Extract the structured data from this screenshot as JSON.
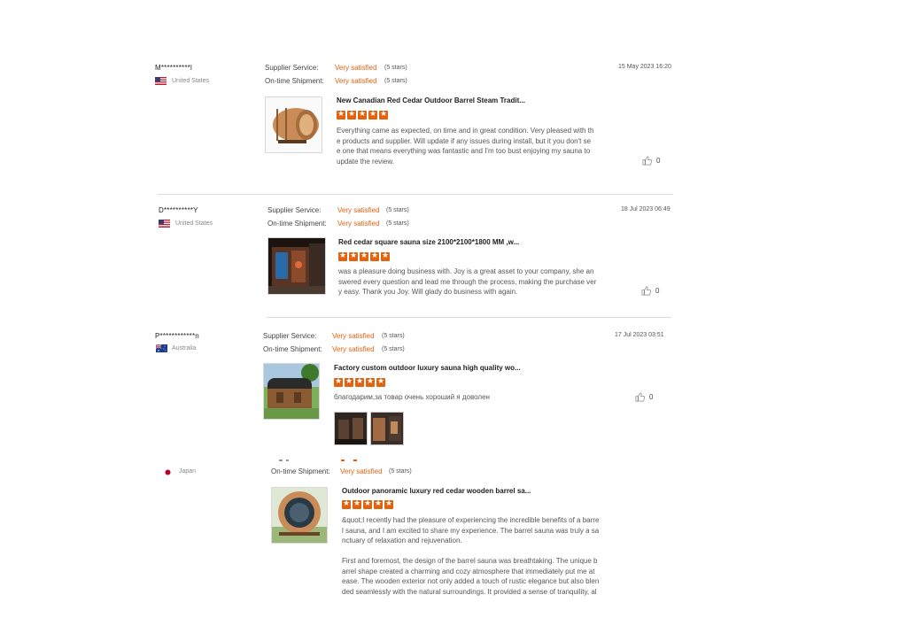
{
  "labels": {
    "supplier_service": "Supplier Service:",
    "on_time_shipment": "On-time Shipment:"
  },
  "colors": {
    "accent": "#e2620f",
    "divider": "#dddddd"
  },
  "reviews": [
    {
      "user": "M**********l",
      "country": "United States",
      "flag": "us-flag-icon",
      "supplier_service": "Very satisfied",
      "supplier_service_stars": "(5 stars)",
      "on_time_shipment": "Very satisfied",
      "on_time_shipment_stars": "(5 stars)",
      "date": "15 May 2023 16:20",
      "product_title": "New Canadian Red Cedar Outdoor Barrel Steam Tradit...",
      "rating": 5,
      "text_lines": [
        "Everything came as expected, on time and in great condition. Very pleased with th",
        "e products and supplier. Will update if any issues during install, but it you don't se",
        "e one that means everything was fantastic and I'm too bust enjoying my sauna to",
        "update the review."
      ],
      "likes": "0"
    },
    {
      "user": "D**********Y",
      "country": "United States",
      "flag": "us-flag-icon",
      "supplier_service": "Very satisfied",
      "supplier_service_stars": "(5 stars)",
      "on_time_shipment": "Very satisfied",
      "on_time_shipment_stars": "(5 stars)",
      "date": "18 Jul 2023 06:49",
      "product_title": "Red cedar square sauna size 2100*2100*1800 MM ,w...",
      "rating": 5,
      "text_lines": [
        "was a pleasure doing business with. Joy is a great asset to your company, she an",
        "swered every question and lead me through the process, making the purchase ver",
        "y easy. Thank you Joy. Will glady do business with again."
      ],
      "likes": "0"
    },
    {
      "user": "P************n",
      "country": "Australia",
      "flag": "au-flag-icon",
      "supplier_service": "Very satisfied",
      "supplier_service_stars": "(5 stars)",
      "on_time_shipment": "Very satisfied",
      "on_time_shipment_stars": "(5 stars)",
      "date": "17 Jul 2023 03:51",
      "product_title": "Factory custom outdoor luxury sauna high quality wo...",
      "rating": 5,
      "text_lines": [
        "благодарим,за товар очень хороший я доволен"
      ],
      "likes": "0"
    },
    {
      "country": "Japan",
      "flag": "jp-flag-icon",
      "on_time_shipment": "Very satisfied",
      "on_time_shipment_stars": "(5 stars)",
      "product_title": "Outdoor panoramic luxury red cedar wooden barrel sa...",
      "rating": 5,
      "text_lines": [
        "&quot;I recently had the pleasure of experiencing the incredible benefits of a barre",
        "l sauna, and I am excited to share my experience. The barrel sauna was truly a sa",
        "nctuary of relaxation and rejuvenation.",
        "",
        "First and foremost, the design of the barrel sauna was breathtaking. The unique b",
        "arrel shape created a charming and cozy atmosphere that immediately put me at",
        "ease. The wooden exterior not only added a touch of rustic elegance but also blen",
        "ded seamlessly with the natural surroundings. It provided a sense of tranquility, al"
      ]
    }
  ]
}
